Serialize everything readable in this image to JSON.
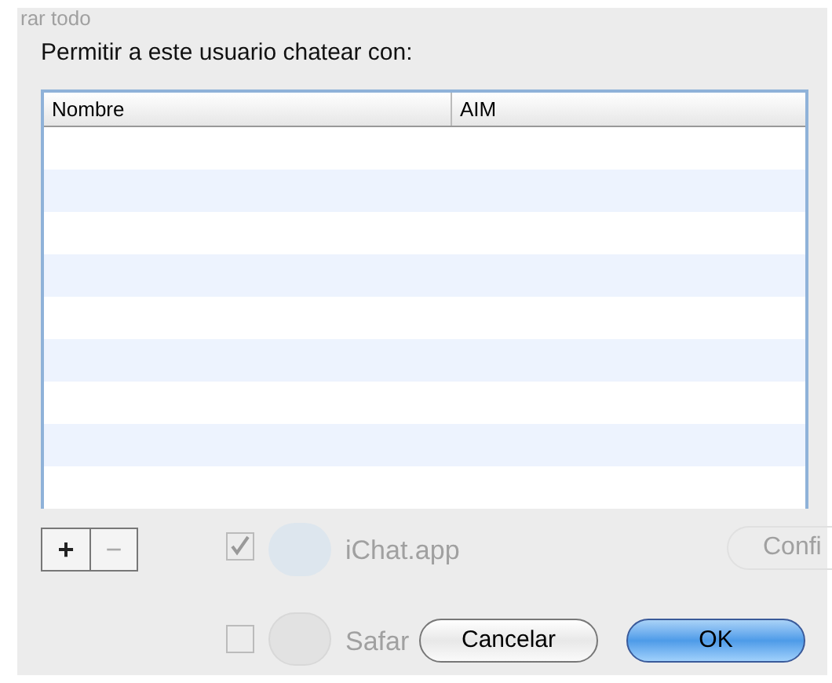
{
  "sheet": {
    "prompt": "Permitir a este usuario chatear con:",
    "table": {
      "columns": [
        "Nombre",
        "AIM"
      ]
    },
    "list_buttons": [
      "+",
      "−"
    ],
    "buttons": [
      {
        "label": "Cancelar",
        "default": false
      },
      {
        "label": "OK",
        "default": true
      }
    ]
  },
  "background_window": {
    "search_text": "rar todo",
    "apps": [
      {
        "name": "iChat.app",
        "checked": true,
        "kind": "chat"
      },
      {
        "name": "Safar",
        "checked": false,
        "kind": "browser"
      }
    ],
    "configure_button": "Confi"
  }
}
